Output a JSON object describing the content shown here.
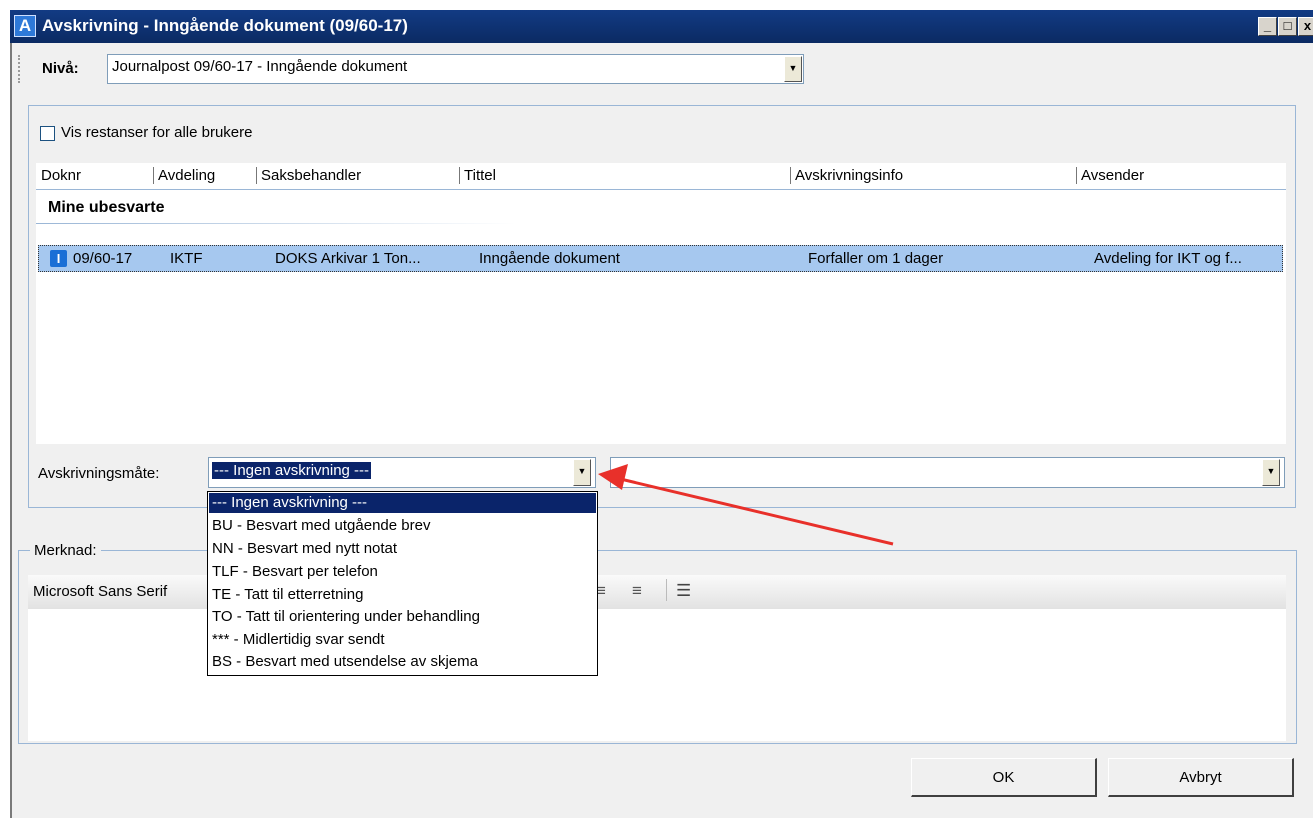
{
  "window": {
    "title": "Avskrivning - Inngående dokument (09/60-17)",
    "app_icon_letter": "A",
    "minimize_glyph": "_",
    "maximize_glyph": "□",
    "close_glyph": "x"
  },
  "toolbar": {
    "niva_label": "Nivå:",
    "niva_value": "Journalpost 09/60-17 - Inngående dokument"
  },
  "panel": {
    "show_all_label": "Vis restanser for alle brukere",
    "show_all_checked": false,
    "columns": [
      "Doknr",
      "Avdeling",
      "Saksbehandler",
      "Tittel",
      "Avskrivningsinfo",
      "Avsender"
    ],
    "group_title": "Mine ubesvarte",
    "rows": [
      {
        "icon": "I",
        "doknr": "09/60-17",
        "avdeling": "IKTF",
        "saksbehandler": "DOKS Arkivar 1 Ton...",
        "tittel": "Inngående dokument",
        "info": "Forfaller om 1 dager",
        "avsender": "Avdeling for IKT og f..."
      }
    ],
    "avskrivningsmate_label": "Avskrivningsmåte:",
    "avskrivningsmate_value": "--- Ingen avskrivning ---",
    "dropdown_options": [
      "--- Ingen avskrivning ---",
      "BU - Besvart med utgående brev",
      "NN - Besvart med nytt notat",
      "TLF - Besvart per telefon",
      "TE - Tatt til etterretning",
      "TO - Tatt til orientering under behandling",
      "*** - Midlertidig svar sendt",
      "BS - Besvart med utsendelse av skjema"
    ],
    "selected_option_index": 0
  },
  "merknad": {
    "label": "Merknad:",
    "font_name": "Microsoft Sans Serif"
  },
  "buttons": {
    "ok": "OK",
    "cancel": "Avbryt"
  },
  "colors": {
    "titlebar": "#0b2a63",
    "selected_row": "#a6c8ef",
    "dropdown_highlight": "#0a246a",
    "annotation_arrow": "#e8302a"
  }
}
